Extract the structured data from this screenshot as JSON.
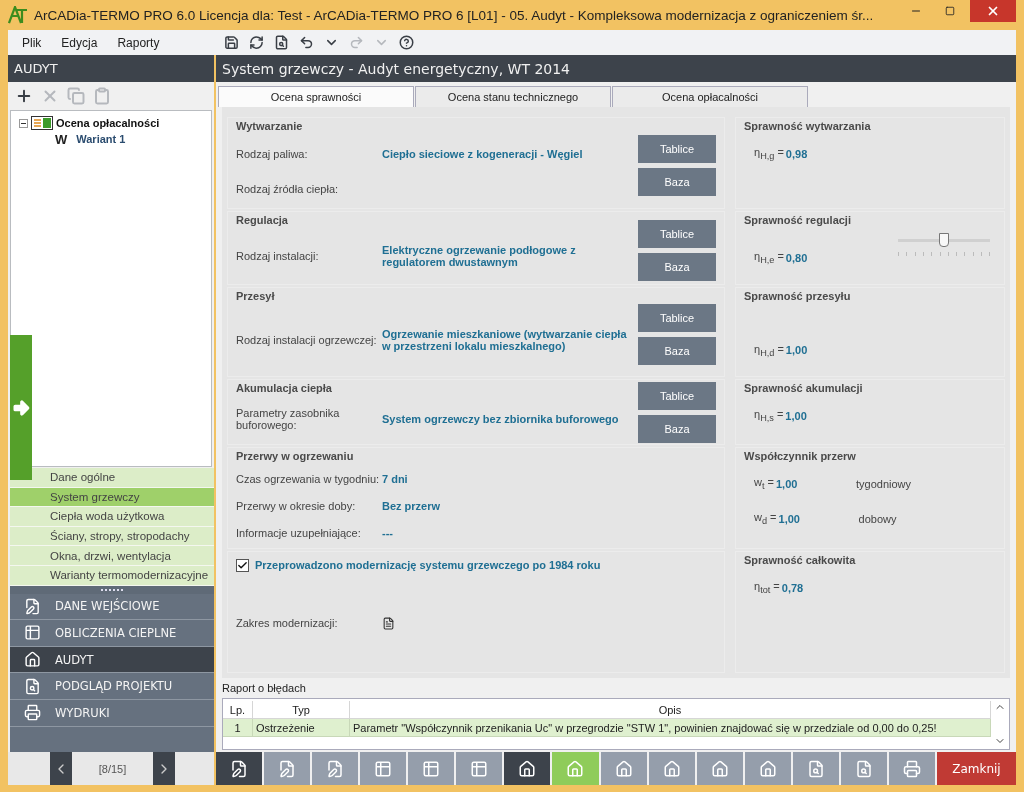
{
  "window": {
    "title": "ArCADia-TERMO PRO 6.0 Licencja dla: Test - ArCADia-TERMO PRO 6 [L01] - 05. Audyt - Kompleksowa modernizacja z ograniczeniem śr..."
  },
  "menu": [
    {
      "label": "Plik"
    },
    {
      "label": "Edycja"
    },
    {
      "label": "Raporty"
    }
  ],
  "toolbar": [
    {
      "kind": "save",
      "disabled": false
    },
    {
      "kind": "refresh",
      "disabled": false
    },
    {
      "kind": "preview",
      "disabled": false
    },
    {
      "kind": "undo",
      "disabled": false
    },
    {
      "kind": "dropdown",
      "disabled": false
    },
    {
      "kind": "redo",
      "disabled": true
    },
    {
      "kind": "dropdown",
      "disabled": true
    },
    {
      "kind": "help",
      "disabled": false
    }
  ],
  "left_panel": {
    "title": "AUDYT",
    "tools": [
      {
        "kind": "plus",
        "disabled": false
      },
      {
        "kind": "close",
        "disabled": true
      },
      {
        "kind": "copy",
        "disabled": true
      },
      {
        "kind": "paste",
        "disabled": true
      }
    ],
    "tree": [
      {
        "label": "Ocena opłacalności",
        "expanded": true,
        "children": [
          {
            "badge": "W",
            "label": "Wariant 1"
          }
        ]
      }
    ],
    "sections": [
      {
        "label": "Dane ogólne",
        "selected": false
      },
      {
        "label": "System grzewczy",
        "selected": true
      },
      {
        "label": "Ciepła woda użytkowa",
        "selected": false
      },
      {
        "label": "Ściany, stropy, stropodachy",
        "selected": false
      },
      {
        "label": "Okna, drzwi, wentylacja",
        "selected": false
      },
      {
        "label": "Warianty termomodernizacyjne",
        "selected": false
      }
    ],
    "modules": [
      {
        "kind": "edit",
        "label": "DANE WEJŚCIOWE",
        "selected": false
      },
      {
        "kind": "table",
        "label": "OBLICZENIA CIEPLNE",
        "selected": false
      },
      {
        "kind": "house",
        "label": "AUDYT",
        "selected": true
      },
      {
        "kind": "preview",
        "label": "PODGLĄD PROJEKTU",
        "selected": false
      },
      {
        "kind": "print",
        "label": "WYDRUKI",
        "selected": false
      }
    ],
    "pager": "[8/15]"
  },
  "main": {
    "title": "System grzewczy - Audyt energetyczny, WT 2014",
    "tabs": [
      {
        "label": "Ocena sprawności",
        "selected": true
      },
      {
        "label": "Ocena stanu technicznego",
        "selected": false
      },
      {
        "label": "Ocena opłacalności",
        "selected": false
      }
    ],
    "sections": [
      {
        "left": {
          "title": "Wytwarzanie",
          "rows": [
            {
              "kind": "text",
              "label": "Rodzaj paliwa:",
              "value": "Ciepło sieciowe z kogeneracji - Węgiel"
            },
            {
              "kind": "text",
              "label": "Rodzaj źródła ciepła:"
            }
          ],
          "buttons": [
            "Tablice",
            "Baza"
          ]
        },
        "right": {
          "title": "Sprawność wytwarzania",
          "items": [
            {
              "symbol": "η$_{H,g}$ =",
              "value": "0,98"
            }
          ]
        }
      },
      {
        "left": {
          "title": "Regulacja",
          "rows": [
            {
              "kind": "text",
              "label": "Rodzaj instalacji:",
              "value": "Elektryczne ogrzewanie podłogowe z regulatorem dwustawnym"
            }
          ],
          "buttons": [
            "Tablice",
            "Baza"
          ]
        },
        "right": {
          "title": "Sprawność regulacji",
          "items": [
            {
              "symbol": "η$_{H,e}$ =",
              "value": "0,80"
            }
          ],
          "slider": {
            "level": 0.5
          }
        }
      },
      {
        "left": {
          "title": "Przesył",
          "rows": [
            {
              "kind": "text",
              "label": "Rodzaj instalacji ogrzewczej:",
              "value": "Ogrzewanie mieszkaniowe (wytwarzanie ciepła w przestrzeni lokalu mieszkalnego)"
            }
          ],
          "buttons": [
            "Tablice",
            "Baza"
          ]
        },
        "right": {
          "title": "Sprawność przesyłu",
          "items": [
            {
              "symbol": "η$_{H,d}$ =",
              "value": "1,00"
            }
          ]
        }
      },
      {
        "left": {
          "title": "Akumulacja ciepła",
          "rows": [
            {
              "kind": "text",
              "label": "Parametry zasobnika buforowego:",
              "value": "System ogrzewczy bez zbiornika buforowego"
            }
          ],
          "buttons": [
            "Tablice",
            "Baza"
          ]
        },
        "right": {
          "title": "Sprawność akumulacji",
          "items": [
            {
              "symbol": "η$_{H,s}$ =",
              "value": "1,00"
            }
          ]
        }
      },
      {
        "left": {
          "title": "Przerwy w ogrzewaniu",
          "rows": [
            {
              "kind": "text",
              "label": "Czas ogrzewania w tygodniu:",
              "value": "7 dni"
            },
            {
              "kind": "text",
              "label": "Przerwy w okresie doby:",
              "value": "Bez przerw"
            },
            {
              "kind": "text",
              "label": "Informacje uzupełniające:",
              "value": "---"
            }
          ]
        },
        "right": {
          "title": "Współczynnik przerw",
          "items": [
            {
              "symbol": "w$_{t}$ =",
              "value": "1,00",
              "note": "tygodniowy"
            },
            {
              "symbol": "w$_{d}$ =",
              "value": "1,00",
              "note": "dobowy"
            }
          ]
        }
      },
      {
        "left": {
          "checkbox": {
            "label": "Przeprowadzono modernizację systemu grzewczego po 1984 roku",
            "checked": true
          },
          "rows": [
            {
              "kind": "icon",
              "label": "Zakres modernizacji:"
            }
          ]
        },
        "right": {
          "title": "Sprawność całkowita",
          "items": [
            {
              "symbol": "η$_{tot}$ =",
              "value": "0,78"
            }
          ]
        }
      }
    ],
    "report": {
      "title": "Raport o błędach",
      "columns": [
        "Lp.",
        "Typ",
        "Opis"
      ],
      "rows": [
        {
          "cells": [
            "1",
            "Ostrzeżenie",
            "Parametr \"Współczynnik przenikania Uc\" w przegrodzie \"STW 1\", powinien znajdować się w przedziale od 0,00 do 0,25!"
          ],
          "selected": true
        }
      ]
    }
  },
  "bottom_toolbar": [
    {
      "kind": "edit",
      "highlighted": true,
      "selected": false
    },
    {
      "kind": "edit",
      "highlighted": false,
      "selected": false
    },
    {
      "kind": "edit",
      "highlighted": false,
      "selected": false
    },
    {
      "kind": "table",
      "highlighted": false,
      "selected": false
    },
    {
      "kind": "table",
      "highlighted": false,
      "selected": false
    },
    {
      "kind": "table",
      "highlighted": false,
      "selected": false
    },
    {
      "kind": "house",
      "highlighted": true,
      "selected": false
    },
    {
      "kind": "house",
      "highlighted": false,
      "selected": true
    },
    {
      "kind": "house",
      "highlighted": false,
      "selected": false
    },
    {
      "kind": "house",
      "highlighted": false,
      "selected": false
    },
    {
      "kind": "house",
      "highlighted": false,
      "selected": false
    },
    {
      "kind": "house",
      "highlighted": false,
      "selected": false
    },
    {
      "kind": "preview",
      "highlighted": false,
      "selected": false
    },
    {
      "kind": "preview",
      "highlighted": false,
      "selected": false
    },
    {
      "kind": "print",
      "highlighted": false,
      "selected": false
    }
  ],
  "close_button": "Zamknij"
}
